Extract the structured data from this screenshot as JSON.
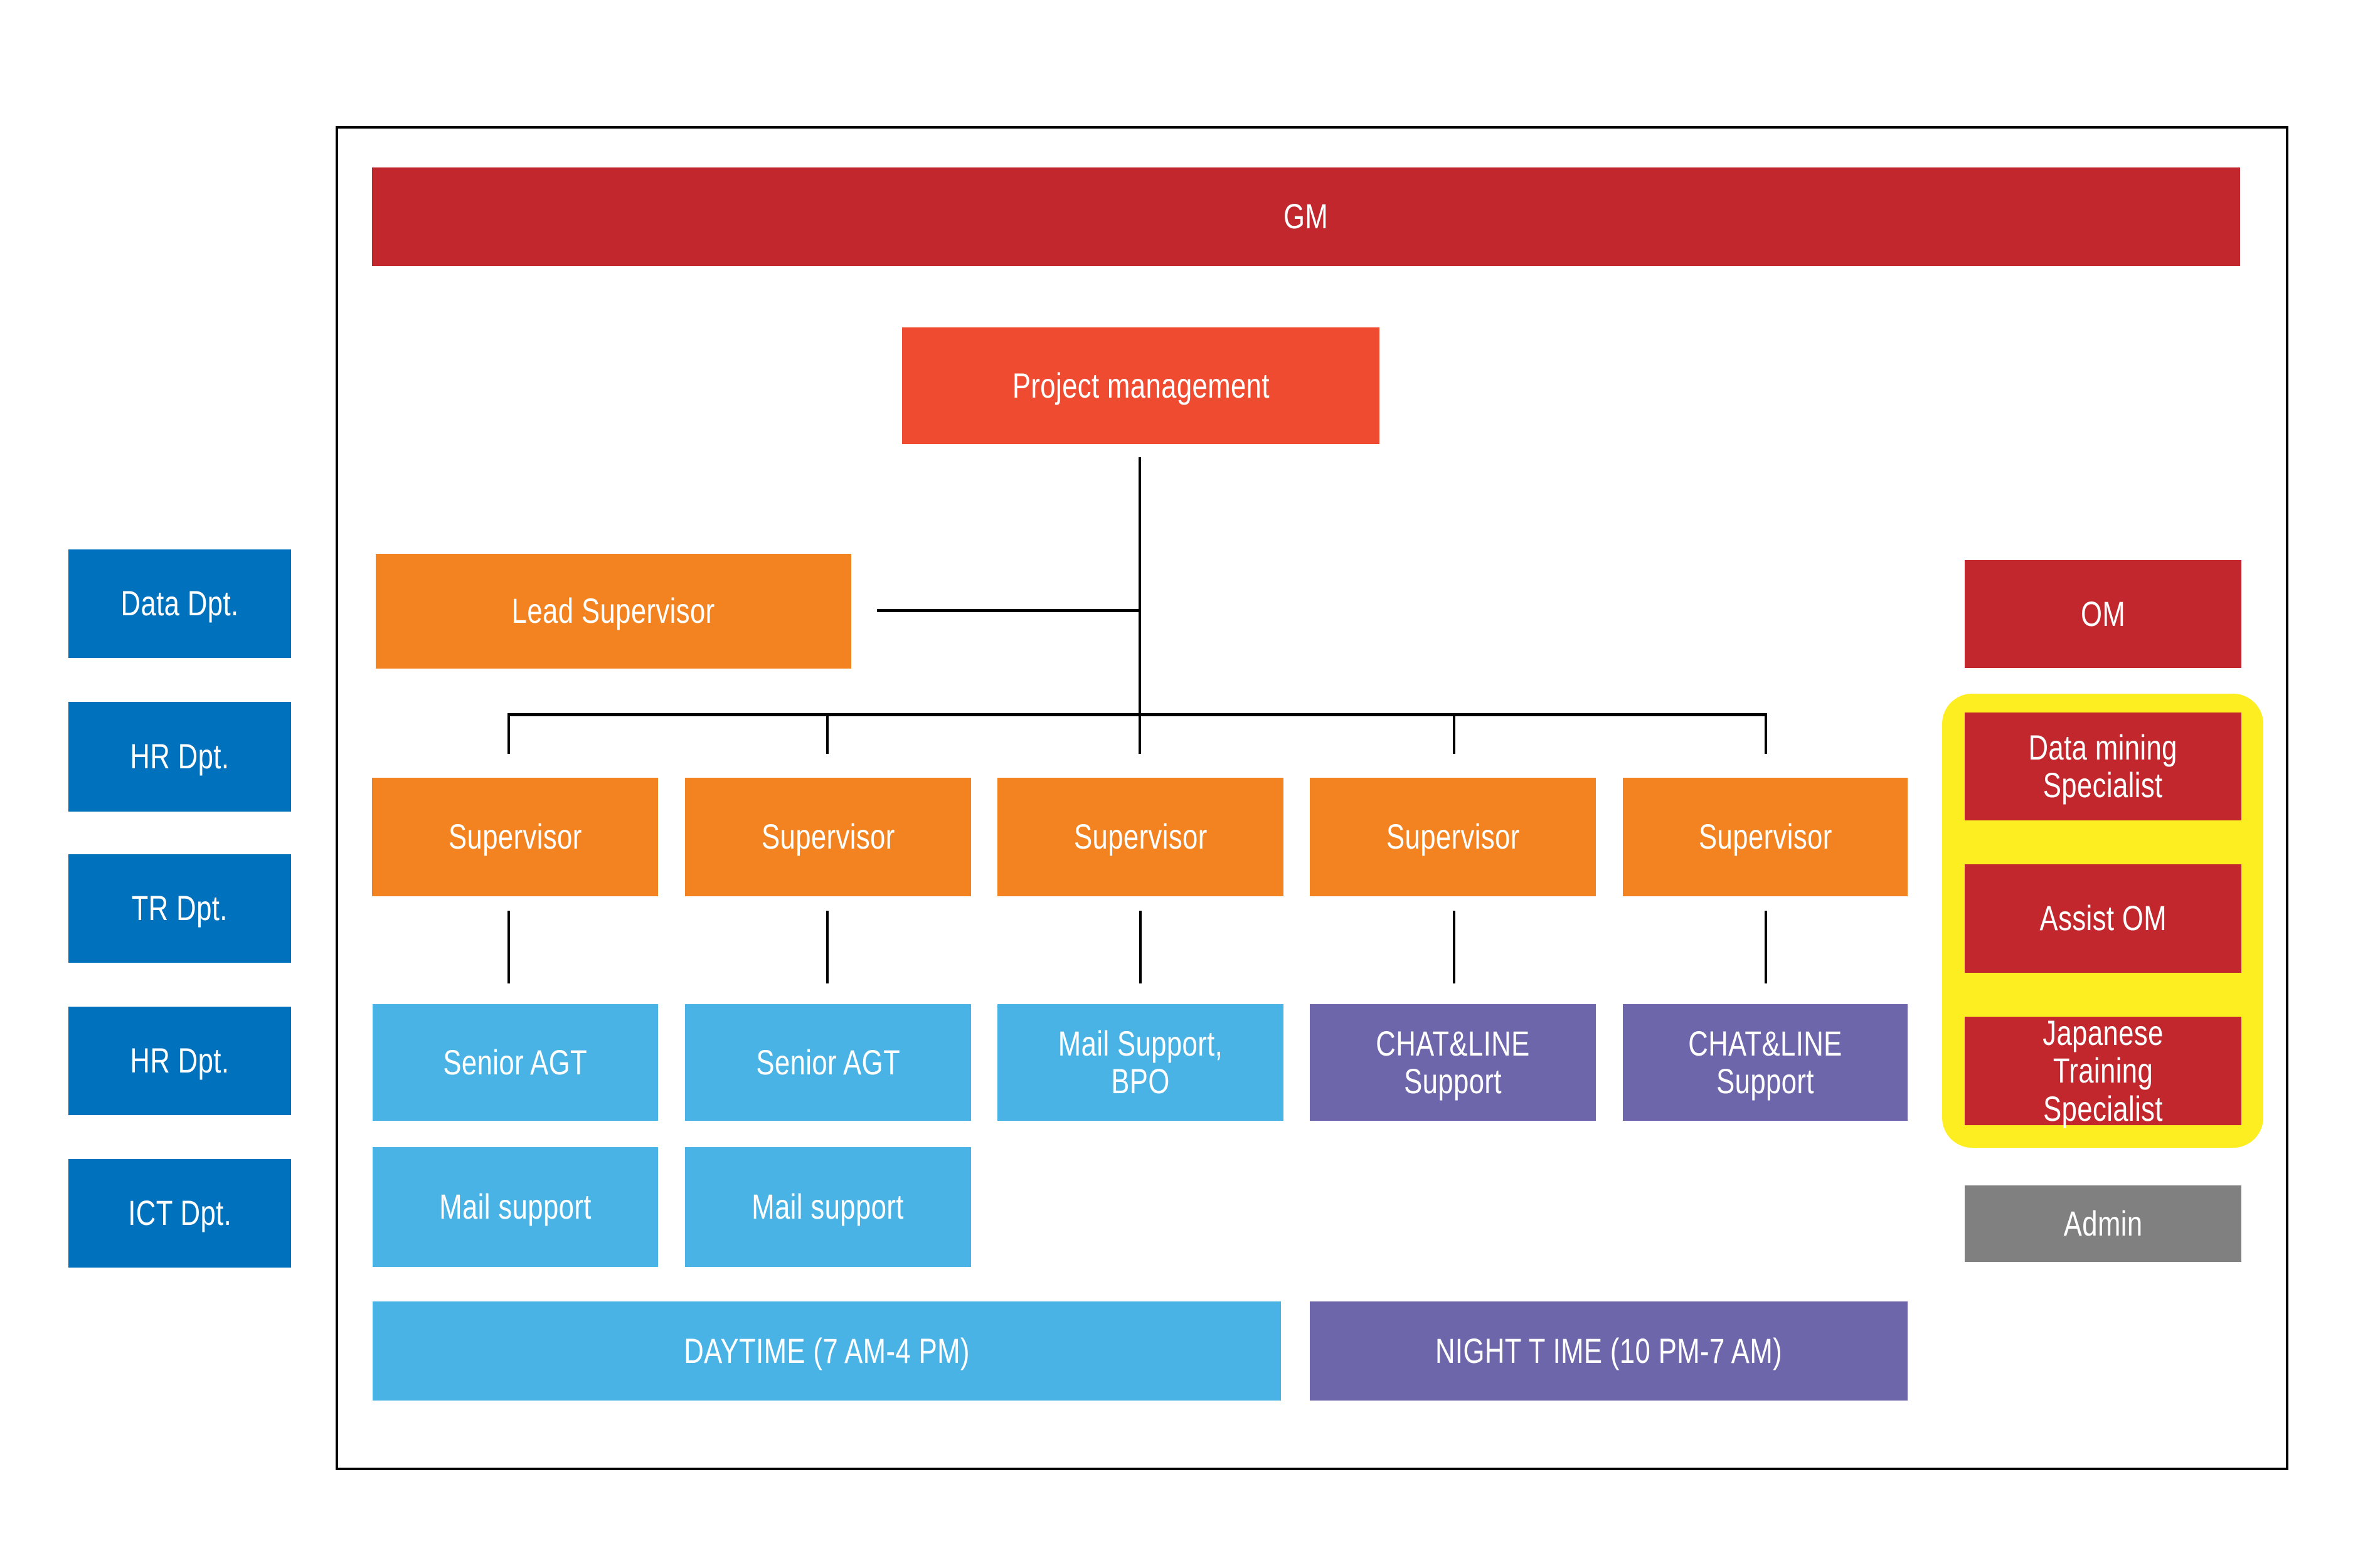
{
  "diagram": {
    "type": "org-chart",
    "top": {
      "label": "GM"
    },
    "project_management": {
      "label": "Project management"
    },
    "lead_supervisor": {
      "label": "Lead Supervisor"
    },
    "supervisors": [
      {
        "label": "Supervisor"
      },
      {
        "label": "Supervisor"
      },
      {
        "label": "Supervisor"
      },
      {
        "label": "Supervisor"
      },
      {
        "label": "Supervisor"
      }
    ],
    "teams": [
      {
        "label": "Senior AGT",
        "shift": "day"
      },
      {
        "label": "Senior AGT",
        "shift": "day"
      },
      {
        "label": "Mail Support, BPO",
        "shift": "day"
      },
      {
        "label": "CHAT&LINE Support",
        "shift": "night"
      },
      {
        "label": "CHAT&LINE Support",
        "shift": "night"
      }
    ],
    "sub_teams": [
      {
        "label": "Mail support"
      },
      {
        "label": "Mail support"
      }
    ],
    "shifts": {
      "daytime": "DAYTIME (7 AM-4 PM)",
      "nighttime": "NIGHT T IME (10 PM-7 AM)"
    },
    "departments": [
      {
        "label": "Data Dpt."
      },
      {
        "label": "HR Dpt."
      },
      {
        "label": "TR Dpt."
      },
      {
        "label": "HR Dpt."
      },
      {
        "label": "ICT Dpt."
      }
    ],
    "right_column": {
      "om": "OM",
      "highlighted": [
        {
          "label": "Data mining\nSpecialist"
        },
        {
          "label": "Assist OM"
        },
        {
          "label": "Japanese Training\nSpecialist"
        }
      ],
      "admin": "Admin"
    },
    "colors": {
      "gm_red": "#C1272D",
      "project_red": "#EE4B31",
      "supervisor_orange": "#F38320",
      "day_blue": "#4AB3E6",
      "night_purple": "#6E66AB",
      "department_blue": "#0071BC",
      "highlight_yellow": "#FCEE21",
      "admin_gray": "#808080"
    }
  }
}
